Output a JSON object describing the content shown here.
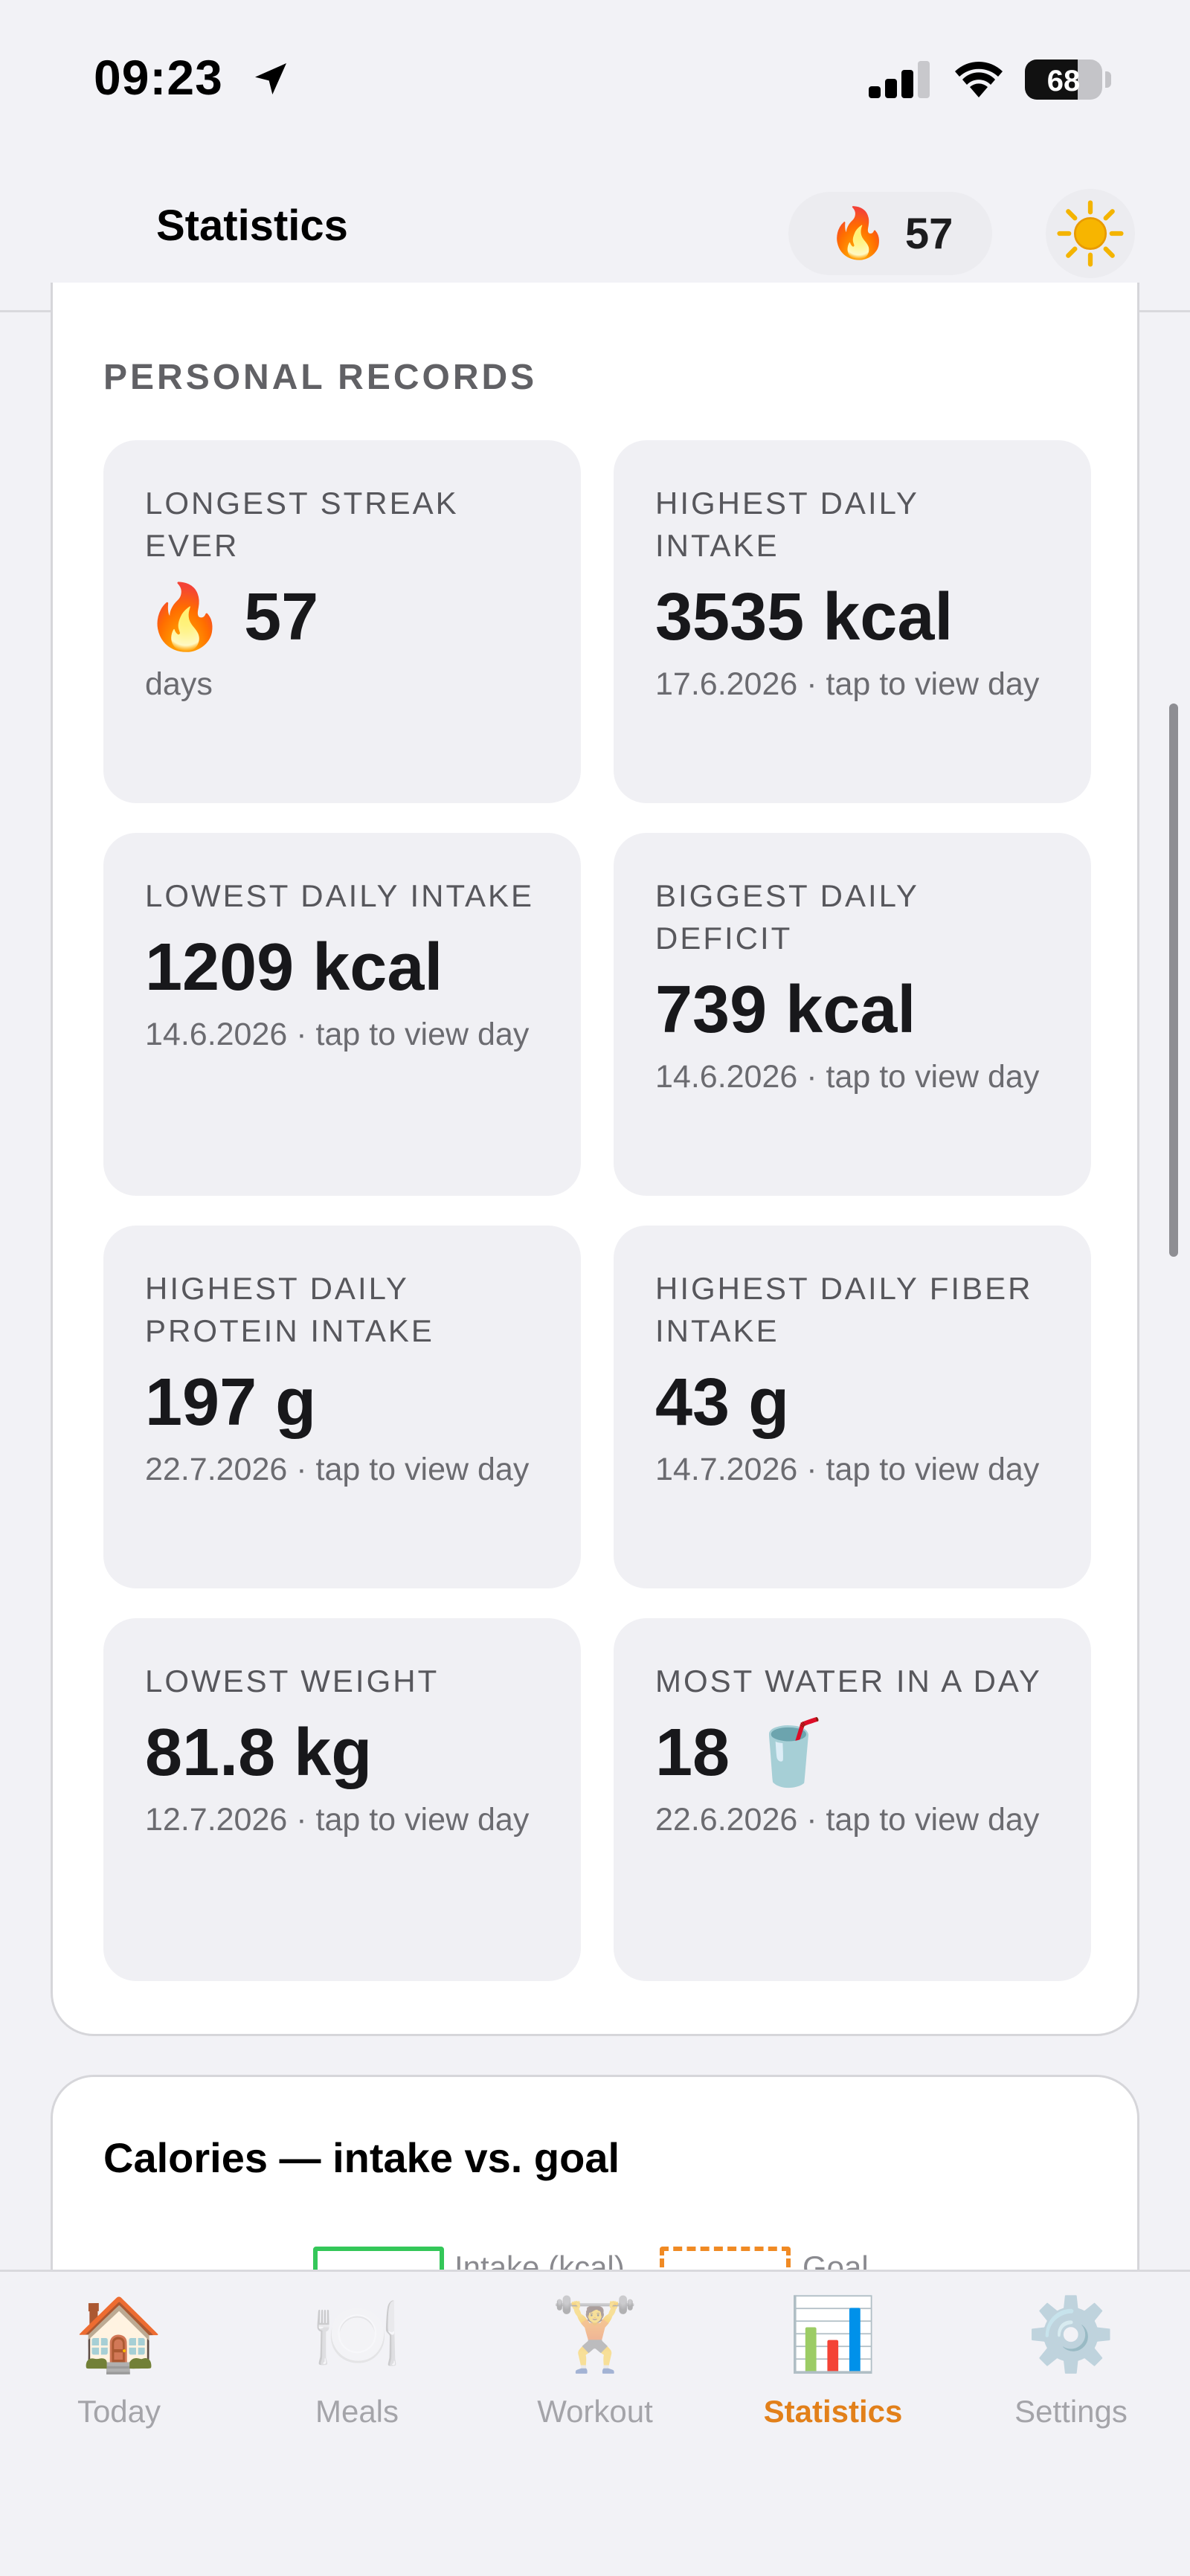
{
  "status_bar": {
    "time": "09:23",
    "battery": "68",
    "battery_level": 0.68
  },
  "header": {
    "title": "Statistics",
    "streak_icon": "🔥",
    "streak_count": "57",
    "theme_icon": "sun-icon"
  },
  "records": {
    "heading": "PERSONAL RECORDS",
    "tiles": [
      {
        "label": "LONGEST STREAK EVER",
        "value": "57",
        "emoji": "🔥",
        "sub": "days"
      },
      {
        "label": "HIGHEST DAILY INTAKE",
        "value": "3535 kcal",
        "sub": "17.6.2026 · tap to view day"
      },
      {
        "label": "LOWEST DAILY INTAKE",
        "value": "1209 kcal",
        "sub": "14.6.2026 · tap to view day"
      },
      {
        "label": "BIGGEST DAILY DEFICIT",
        "value": "739 kcal",
        "sub": "14.6.2026 · tap to view day"
      },
      {
        "label": "HIGHEST DAILY PROTEIN INTAKE",
        "value": "197 g",
        "sub": "22.7.2026 · tap to view day"
      },
      {
        "label": "HIGHEST DAILY FIBER INTAKE",
        "value": "43 g",
        "sub": "14.7.2026 · tap to view day"
      },
      {
        "label": "LOWEST WEIGHT",
        "value": "81.8 kg",
        "sub": "12.7.2026 · tap to view day"
      },
      {
        "label": "MOST WATER IN A DAY",
        "value": "18",
        "emoji": "🥤",
        "sub": "22.6.2026 · tap to view day"
      }
    ]
  },
  "calories": {
    "title": "Calories — intake vs. goal",
    "legend": [
      {
        "label": "Intake (kcal)",
        "color": "#34c759"
      },
      {
        "label": "Goal",
        "color": "#f08a24"
      }
    ]
  },
  "tabs": [
    {
      "label": "Today",
      "icon": "🏠",
      "active": false
    },
    {
      "label": "Meals",
      "icon": "🍽️",
      "active": false
    },
    {
      "label": "Workout",
      "icon": "🏋️",
      "active": false
    },
    {
      "label": "Statistics",
      "icon": "📊",
      "active": true
    },
    {
      "label": "Settings",
      "icon": "⚙️",
      "active": false
    }
  ],
  "colors": {
    "accent": "#e2801a",
    "background": "#f2f2f6",
    "card": "#ffffff",
    "tile": "#f0f0f4"
  }
}
